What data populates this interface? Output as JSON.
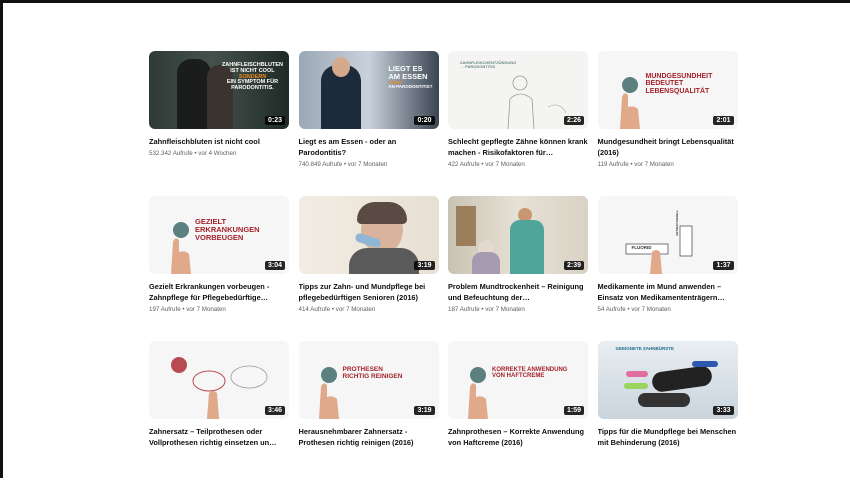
{
  "videos": [
    {
      "title": "Zahnfleischbluten ist nicht cool",
      "meta": "532.342 Aufrufe • vor 4 Wochen",
      "duration": "0:23",
      "overlay": [
        "ZAHNFLEISCHBLUTEN",
        "IST NICHT COOL",
        "SONDERN",
        "EIN SYMPTOM FÜR",
        "PARODONTITIS."
      ]
    },
    {
      "title": "Liegt es am Essen - oder an Parodontitis?",
      "meta": "740.849 Aufrufe • vor 7 Monaten",
      "duration": "0:20",
      "overlay": [
        "LIEGT ES",
        "AM ESSEN",
        "ODER",
        "AN PARODONTITIS?"
      ]
    },
    {
      "title": "Schlecht gepflegte Zähne können krank machen - Risikofaktoren für…",
      "meta": "422 Aufrufe • vor 7 Monaten",
      "duration": "2:26",
      "overlay": [
        "ZAHNFLEISCHENTZÜNDUNG",
        "→ PARODONTITIS"
      ]
    },
    {
      "title": "Mundgesundheit bringt Lebensqualität (2016)",
      "meta": "119 Aufrufe • vor 7 Monaten",
      "duration": "2:01",
      "overlay": [
        "MUNDGESUNDHEIT",
        "BEDEUTET",
        "LEBENSQUALITÄT"
      ]
    },
    {
      "title": "Gezielt Erkrankungen vorbeugen - Zahnpflege für Pflegebedürftige…",
      "meta": "197 Aufrufe • vor 7 Monaten",
      "duration": "3:04",
      "overlay": [
        "GEZIELT",
        "ERKRANKUNGEN",
        "VORBEUGEN"
      ]
    },
    {
      "title": "Tipps zur Zahn- und Mundpflege bei pflegebedürftigen Senioren (2016)",
      "meta": "414 Aufrufe • vor 7 Monaten",
      "duration": "3:19",
      "overlay": []
    },
    {
      "title": "Problem Mundtrockenheit – Reinigung und Befeuchtung der…",
      "meta": "187 Aufrufe • vor 7 Monaten",
      "duration": "2:39",
      "overlay": []
    },
    {
      "title": "Medikamente im Mund anwenden – Einsatz von Medikamententrägern…",
      "meta": "54 Aufrufe • vor 7 Monaten",
      "duration": "1:37",
      "overlay": [
        "FLUORID",
        "ANTIBAKTERIELL"
      ]
    },
    {
      "title": "Zahnersatz – Teilprothesen oder Vollprothesen richtig einsetzen un…",
      "meta": "",
      "duration": "3:46",
      "overlay": []
    },
    {
      "title": "Herausnehmbarer Zahnersatz - Prothesen richtig reinigen (2016)",
      "meta": "",
      "duration": "3:19",
      "overlay": [
        "PROTHESEN",
        "RICHTIG REINIGEN"
      ]
    },
    {
      "title": "Zahnprothesen – Korrekte Anwendung von Haftcreme (2016)",
      "meta": "",
      "duration": "1:59",
      "overlay": [
        "KORREKTE ANWENDUNG",
        "VON HAFTCREME"
      ]
    },
    {
      "title": "Tipps für die Mundpflege bei Menschen mit Behinderung (2016)",
      "meta": "",
      "duration": "3:33",
      "overlay": [
        "GEEIGNETE ZAHNBÜRSTE"
      ]
    }
  ]
}
